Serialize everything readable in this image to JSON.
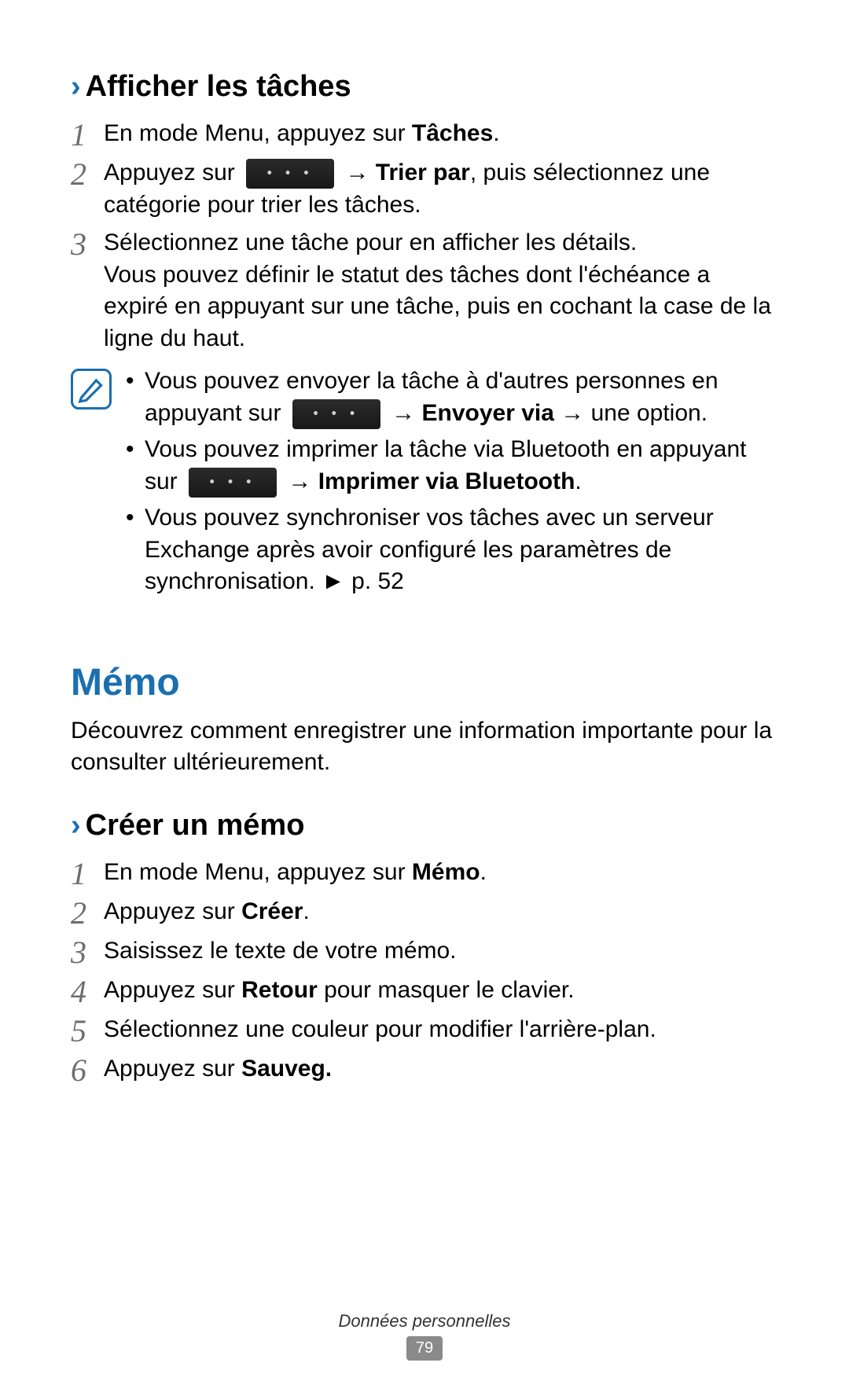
{
  "section1": {
    "heading": "Afficher les tâches",
    "step1": {
      "pre": "En mode Menu, appuyez sur ",
      "bold": "Tâches",
      "post": "."
    },
    "step2": {
      "pre": "Appuyez sur ",
      "arrow_bold": "→ Trier par",
      "post": ", puis sélectionnez une catégorie pour trier les tâches."
    },
    "step3": {
      "line1": "Sélectionnez une tâche pour en afficher les détails.",
      "line2": "Vous pouvez définir le statut des tâches dont l'échéance a expiré en appuyant sur une tâche, puis en cochant la case de la ligne du haut."
    },
    "note": {
      "b1_pre": "Vous pouvez envoyer la tâche à d'autres personnes en appuyant sur ",
      "b1_arrow1": "→ ",
      "b1_bold": "Envoyer via",
      "b1_arrow2": " → une option.",
      "b2_pre": "Vous pouvez imprimer la tâche via Bluetooth en appuyant sur ",
      "b2_arrow": "→ ",
      "b2_bold": "Imprimer via Bluetooth",
      "b2_post": ".",
      "b3": "Vous pouvez synchroniser vos tâches avec un serveur Exchange après avoir configuré les paramètres de synchronisation. ► p. 52"
    }
  },
  "section2": {
    "title": "Mémo",
    "intro": "Découvrez comment enregistrer une information importante pour la consulter ultérieurement.",
    "heading": "Créer un mémo",
    "step1": {
      "pre": "En mode Menu, appuyez sur ",
      "bold": "Mémo",
      "post": "."
    },
    "step2": {
      "pre": "Appuyez sur ",
      "bold": "Créer",
      "post": "."
    },
    "step3": "Saisissez le texte de votre mémo.",
    "step4": {
      "pre": "Appuyez sur ",
      "bold": "Retour",
      "post": " pour masquer le clavier."
    },
    "step5": "Sélectionnez une couleur pour modifier l'arrière-plan.",
    "step6": {
      "pre": "Appuyez sur ",
      "bold": "Sauveg."
    }
  },
  "footer": {
    "category": "Données personnelles",
    "page": "79"
  },
  "steps_numbers": [
    "1",
    "2",
    "3",
    "4",
    "5",
    "6"
  ]
}
